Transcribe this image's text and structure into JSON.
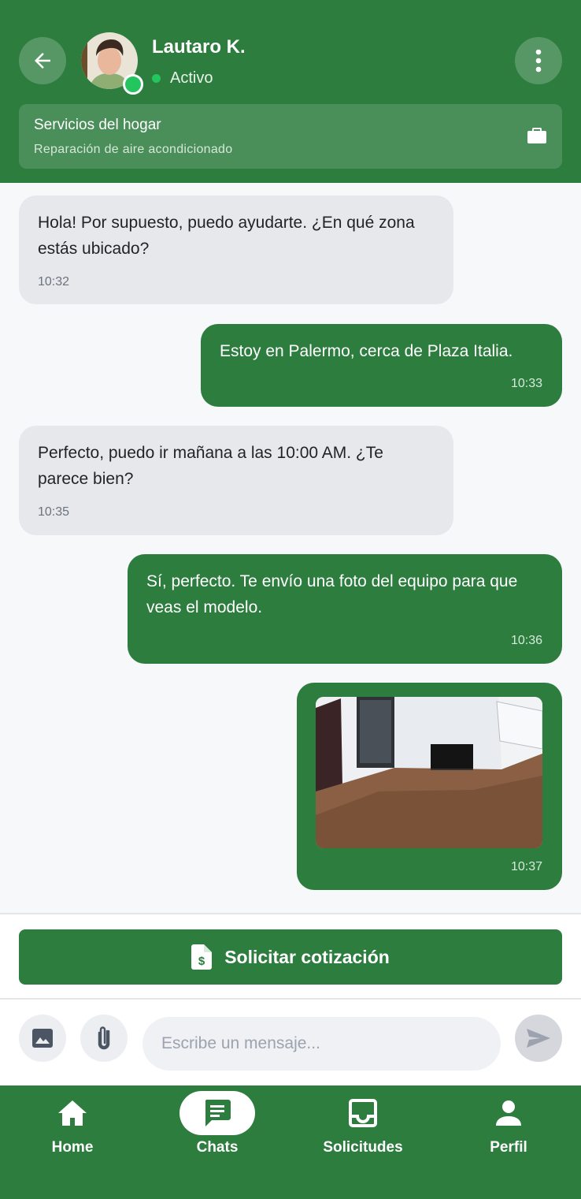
{
  "header": {
    "contact_name": "Lautaro K.",
    "status": "Activo",
    "service": {
      "title": "Servicios del hogar",
      "subtitle": "Reparación de aire acondicionado"
    }
  },
  "messages": [
    {
      "direction": "in",
      "text": "Hola! Por supuesto, puedo ayudarte. ¿En qué zona estás ubicado?",
      "time": "10:32"
    },
    {
      "direction": "out",
      "text": "Estoy en Palermo, cerca de Plaza Italia.",
      "time": "10:33"
    },
    {
      "direction": "in",
      "text": "Perfecto, puedo ir mañana a las 10:00 AM. ¿Te parece bien?",
      "time": "10:35"
    },
    {
      "direction": "out",
      "text": "Sí, perfecto. Te envío una foto del equipo para que veas el modelo.",
      "time": "10:36"
    },
    {
      "direction": "out",
      "type": "image",
      "time": "10:37"
    }
  ],
  "quote_button": {
    "label": "Solicitar cotización"
  },
  "composer": {
    "placeholder": "Escribe un mensaje..."
  },
  "nav": {
    "items": [
      {
        "label": "Home",
        "icon": "home-icon"
      },
      {
        "label": "Chats",
        "icon": "chat-icon",
        "active": true
      },
      {
        "label": "Solicitudes",
        "icon": "inbox-icon"
      },
      {
        "label": "Perfil",
        "icon": "person-icon"
      }
    ]
  },
  "colors": {
    "brand": "#2d7d3f",
    "online": "#22c55e",
    "incoming_bubble": "#e7e8eb"
  }
}
